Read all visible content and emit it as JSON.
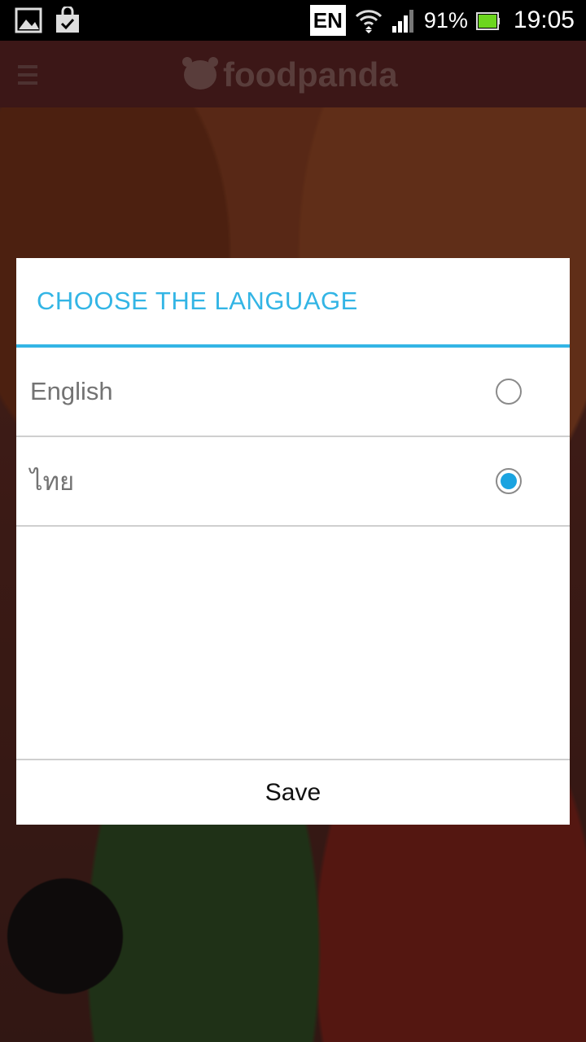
{
  "status_bar": {
    "input_language": "EN",
    "battery_percent": "91%",
    "time": "19:05"
  },
  "app_header": {
    "logo_text": "foodpanda"
  },
  "dialog": {
    "title": "CHOOSE THE LANGUAGE",
    "options": [
      {
        "label": "English",
        "selected": false
      },
      {
        "label": "ไทย",
        "selected": true
      }
    ],
    "save_label": "Save"
  },
  "colors": {
    "accent": "#33b5e5",
    "header": "#6d2b2b"
  }
}
